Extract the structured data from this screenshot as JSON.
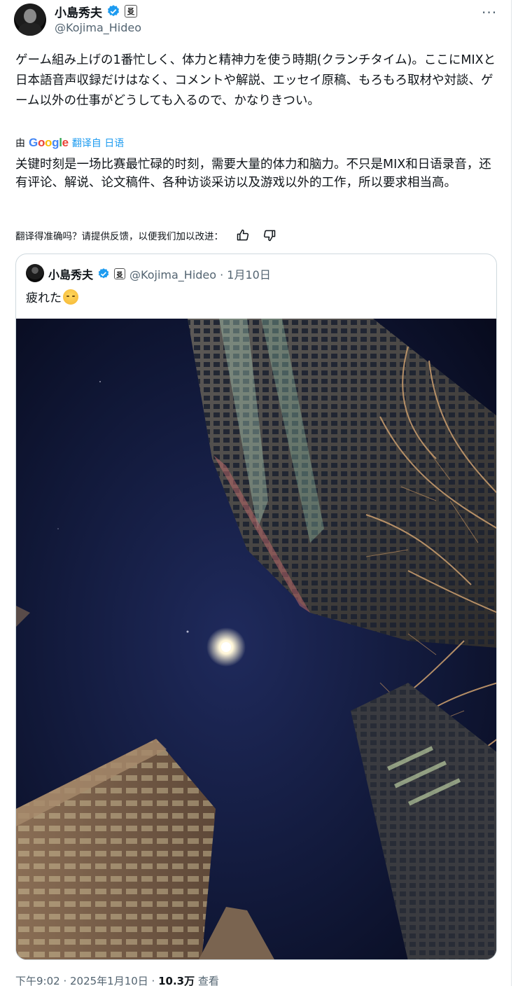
{
  "tweet": {
    "author": {
      "display_name": "小島秀夫",
      "handle": "@Kojima_Hideo"
    },
    "more_label": "···",
    "text_jp": "ゲーム組み上げの1番忙しく、体力と精神力を使う時期(クランチタイム)。ここにMIXと日本語音声収録だけはなく、コメントや解説、エッセイ原稿、もろもろ取材や対談、ゲーム以外の仕事がどうしても入るので、かなりきつい。",
    "translation": {
      "by_label": "由",
      "google_letters": [
        "G",
        "o",
        "o",
        "g",
        "l",
        "e"
      ],
      "link_label": "翻译自 日语",
      "text_zh": "关键时刻是一场比赛最忙碌的时刻，需要大量的体力和脑力。不只是MIX和日语录音，还有评论、解说、论文稿件、各种访谈采访以及游戏以外的工作，所以要求相当高。"
    },
    "feedback": {
      "prompt": "翻译得准确吗？请提供反馈，以便我们加以改进："
    },
    "quoted": {
      "display_name": "小島秀夫",
      "handle_date": "@Kojima_Hideo · 1月10日",
      "text": "疲れた"
    },
    "meta": {
      "time_date": "下午9:02 · 2025年1月10日 · ",
      "views_count": "10.3万",
      "views_label": " 查看"
    }
  },
  "colors": {
    "accent": "#1d9bf0",
    "secondary_text": "#536471",
    "border": "#cfd9de",
    "google_blue": "#4285F4",
    "google_red": "#EA4335",
    "google_yellow": "#FBBC05",
    "google_green": "#34A853"
  },
  "icons": [
    "verified-badge-icon",
    "affiliate-badge-icon",
    "more-icon",
    "thumbs-up-icon",
    "thumbs-down-icon",
    "tired-face-emoji"
  ]
}
